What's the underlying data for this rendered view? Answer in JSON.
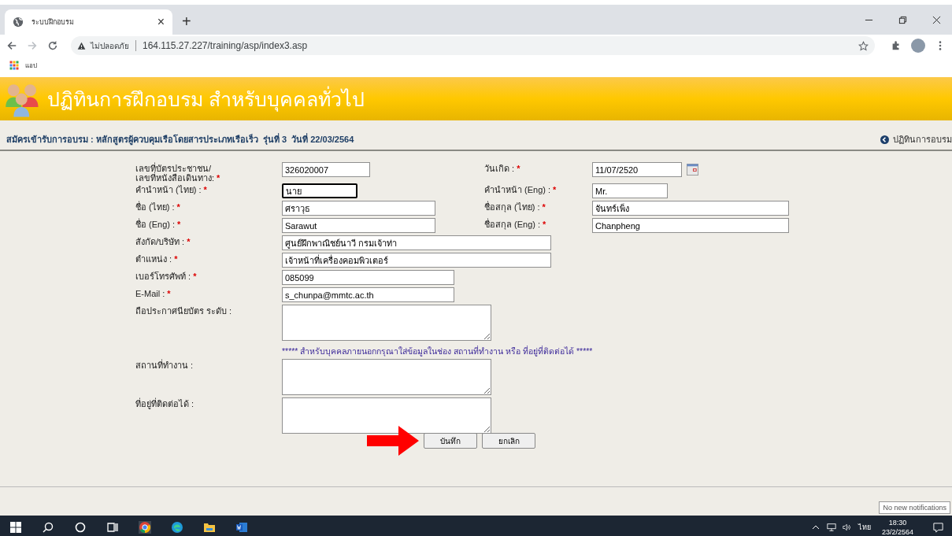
{
  "browser": {
    "tab": {
      "title": "ระบบฝึกอบรม",
      "close": "×",
      "selected": true
    },
    "new_tab": "+",
    "security": "ไม่ปลอดภัย",
    "url": "164.115.27.227/training/asp/index3.asp",
    "bookmarks": [
      {
        "label": "แอป"
      }
    ]
  },
  "header": {
    "title": "ปฏิทินการฝึกอบรม สำหรับบุคคลทั่วไป"
  },
  "subheader": {
    "title": "สมัครเข้ารับการอบรม : หลักสูตรผู้ควบคุมเรือโดยสารประเภทเรือเร็ว  รุ่นที่ 3  วันที่ 22/03/2564",
    "link": "ปฏิทินการอบรม"
  },
  "form": {
    "rows": [
      {
        "kind": "pair",
        "fields": [
          {
            "kind": "text",
            "label": "เลขที่บัตรประชาชน/\nเลขที่หนังสือเดินทาง:",
            "asterisk": "*",
            "value": "326020007",
            "focused": false
          },
          {
            "kind": "date",
            "label": "วันเกิด :",
            "asterisk": "*",
            "value": "11/07/2520",
            "focused": false
          }
        ]
      },
      {
        "kind": "pair",
        "fields": [
          {
            "kind": "text",
            "label": "คำนำหน้า (ไทย) :",
            "asterisk": "*",
            "value": "นาย",
            "focused": true
          },
          {
            "kind": "text",
            "label": "คำนำหน้า (Eng) :",
            "asterisk": "*",
            "value": "Mr.",
            "focused": false
          }
        ]
      },
      {
        "kind": "pair",
        "fields": [
          {
            "kind": "text",
            "label": "ชื่อ (ไทย) :",
            "asterisk": "*",
            "value": "ศราวุธ",
            "focused": false
          },
          {
            "kind": "text",
            "label": "ชื่อสกุล (ไทย) :",
            "asterisk": "*",
            "value": "จันทร์เพ็ง",
            "focused": false
          }
        ]
      },
      {
        "kind": "pair",
        "fields": [
          {
            "kind": "text",
            "label": "ชื่อ (Eng) :",
            "asterisk": "*",
            "value": "Sarawut",
            "focused": false
          },
          {
            "kind": "text",
            "label": "ชื่อสกุล (Eng) :",
            "asterisk": "*",
            "value": "Chanpheng",
            "focused": false
          }
        ]
      },
      {
        "kind": "single",
        "fields": [
          {
            "kind": "text",
            "label": "สังกัด/บริษัท :",
            "asterisk": "*",
            "value": "ศูนย์ฝึกพาณิชย์นาวี กรมเจ้าท่า",
            "focused": false
          }
        ]
      },
      {
        "kind": "single",
        "fields": [
          {
            "kind": "text",
            "label": "ตำแหน่ง :",
            "asterisk": "*",
            "value": "เจ้าหน้าที่เครื่องคอมพิวเตอร์",
            "focused": false
          }
        ]
      },
      {
        "kind": "single",
        "fields": [
          {
            "kind": "text",
            "label": "เบอร์โทรศัพท์ :",
            "asterisk": "*",
            "value": "085099",
            "focused": false
          }
        ]
      },
      {
        "kind": "single",
        "fields": [
          {
            "kind": "text",
            "label": "E-Mail :",
            "asterisk": "*",
            "value": "s_chunpa@mmtc.ac.th",
            "focused": false
          }
        ]
      },
      {
        "kind": "single",
        "fields": [
          {
            "kind": "textarea",
            "label": "ถือประกาศนียบัตร ระดับ :",
            "focused": false
          }
        ]
      },
      {
        "kind": "note",
        "text": "***** สำหรับบุคคลภายนอกกรุณาใส่ข้อมูลในช่อง สถานที่ทำงาน หรือ ที่อยู่ที่ติดต่อได้ *****"
      },
      {
        "kind": "single",
        "fields": [
          {
            "kind": "textarea",
            "label": "สถานที่ทำงาน :",
            "focused": false
          }
        ]
      },
      {
        "kind": "single",
        "fields": [
          {
            "kind": "textarea",
            "label": "ที่อยู่ที่ติดต่อได้ :",
            "focused": false
          }
        ]
      },
      {
        "kind": "buttons",
        "buttons": [
          "บันทึก",
          "ยกเลิก"
        ]
      }
    ]
  },
  "notification": {
    "text": "No new notifications"
  },
  "taskbar": {
    "language": "ไทย",
    "time": "18:30",
    "date": "23/2/2564"
  }
}
